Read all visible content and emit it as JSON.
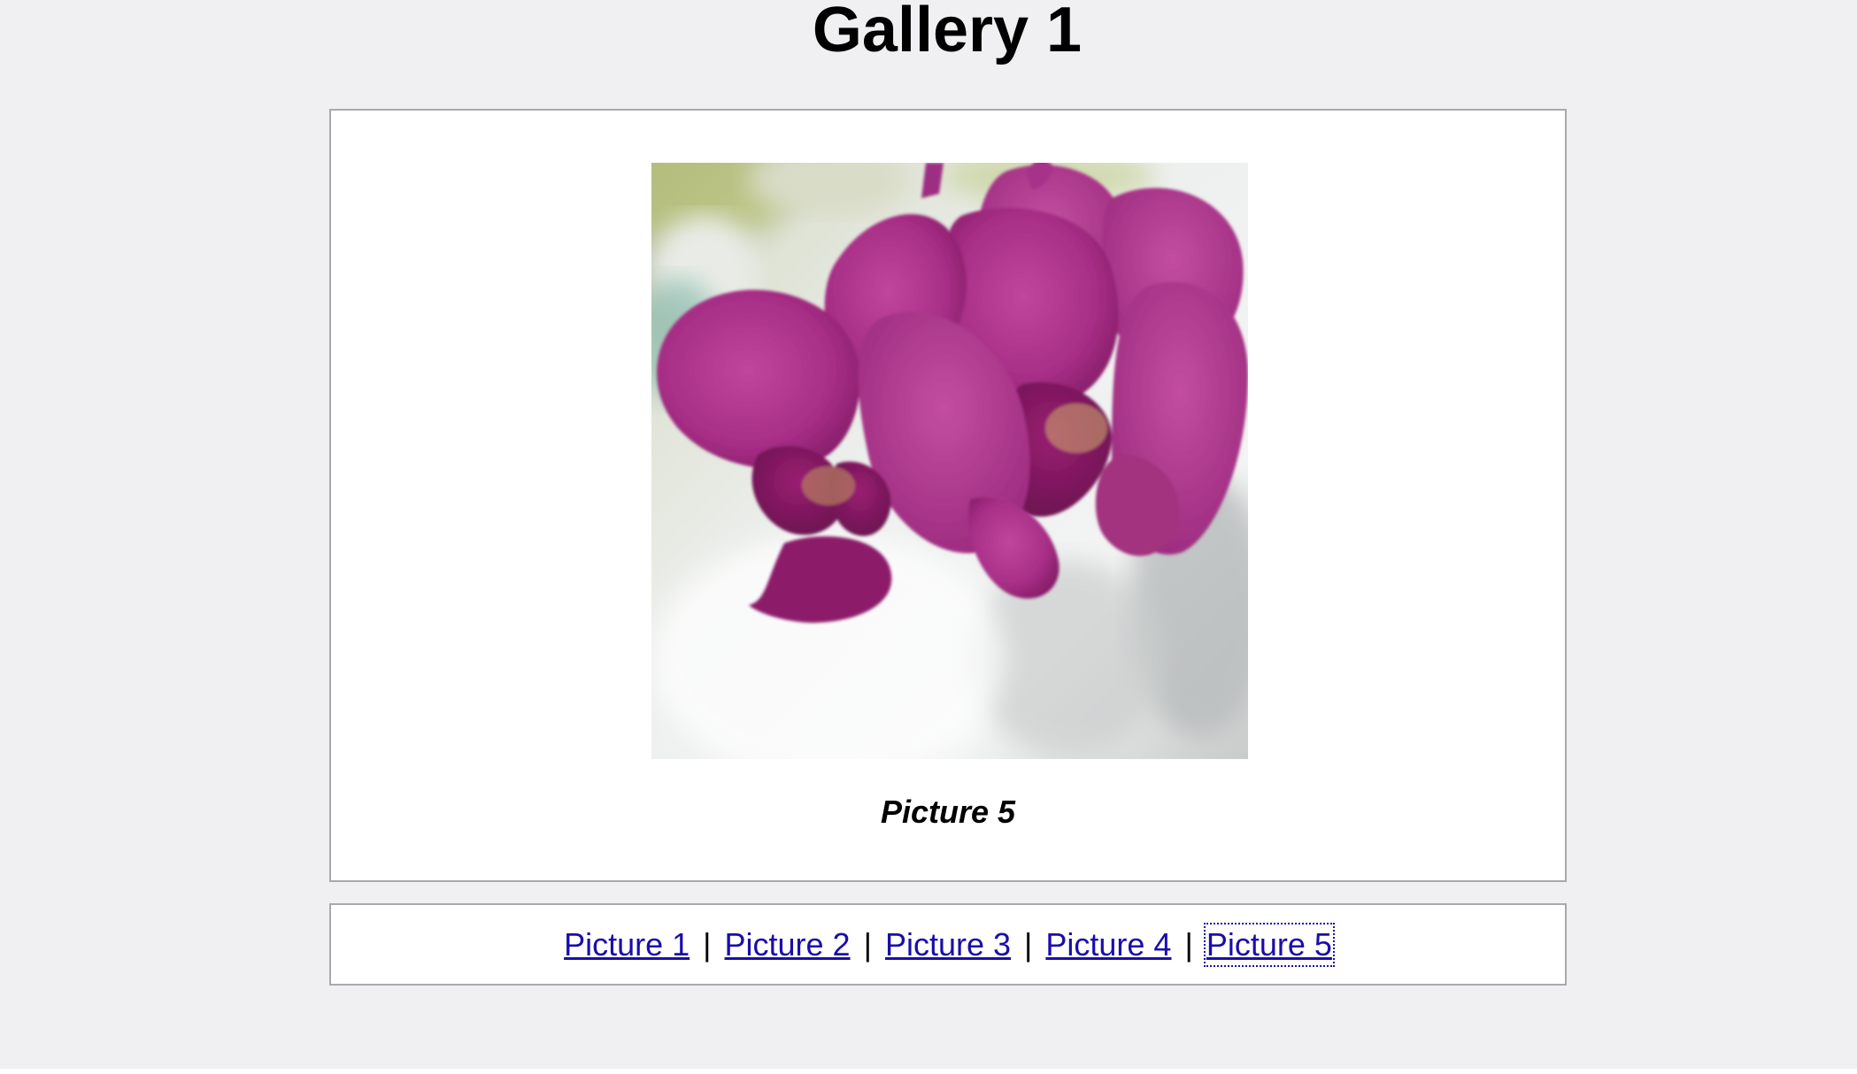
{
  "page": {
    "title": "Gallery 1"
  },
  "viewer": {
    "image_subject": "magenta orchid flowers",
    "caption": "Picture 5"
  },
  "nav": {
    "links": [
      "Picture 1",
      "Picture 2",
      "Picture 3",
      "Picture 4",
      "Picture 5"
    ],
    "separator": "|",
    "current": "Picture 5"
  },
  "colors": {
    "background": "#f0f0f2",
    "panel": "#ffffff",
    "border": "#a9a9ad",
    "link": "#1a0dab",
    "orchid": "#b5338f"
  }
}
